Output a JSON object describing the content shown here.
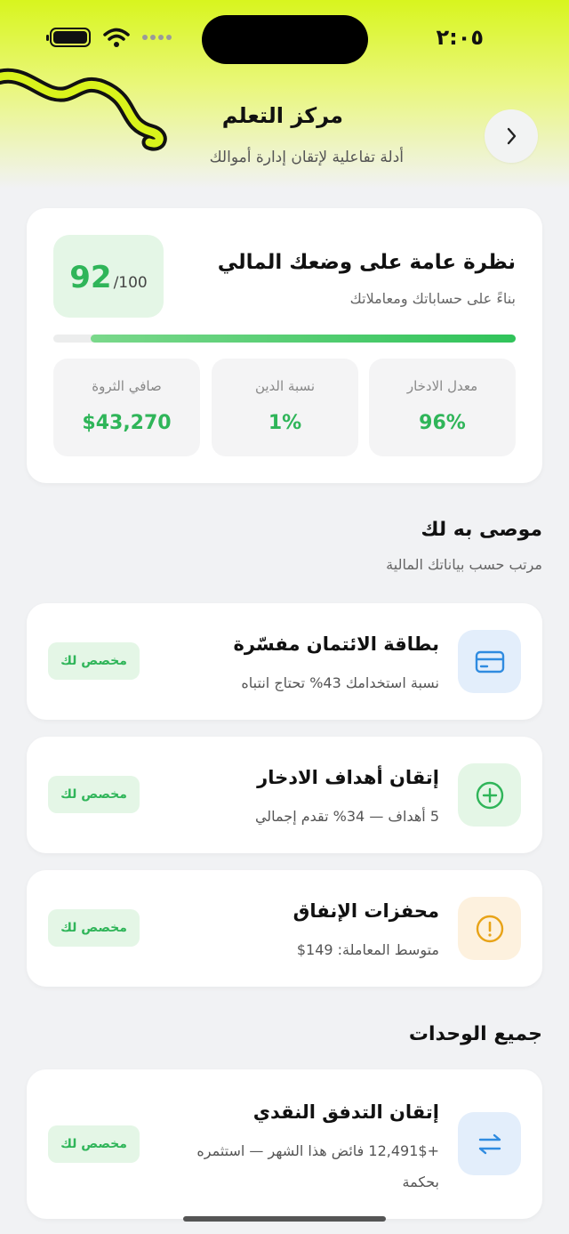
{
  "status": {
    "time": "٢:٠٥"
  },
  "header": {
    "title": "مركز التعلم",
    "subtitle": "أدلة تفاعلية لإتقان إدارة أموالك",
    "back_icon": "chevron-right-icon"
  },
  "overview": {
    "title": "نظرة عامة على وضعك المالي",
    "subtitle": "بناءً على حساباتك ومعاملاتك",
    "score": "92",
    "score_max": "/100",
    "progress_fraction": 0.92,
    "metrics": [
      {
        "label": "معدل الادخار",
        "value": "96%"
      },
      {
        "label": "نسبة الدين",
        "value": "1%"
      },
      {
        "label": "صافي الثروة",
        "value": "$43,270"
      }
    ]
  },
  "recommended": {
    "title": "موصى به لك",
    "subtitle": "مرتب حسب بياناتك المالية",
    "items": [
      {
        "title": "بطاقة الائتمان مفسّرة",
        "subtitle": "نسبة استخدامك 43% تحتاج انتباه",
        "badge": "مخصص لك",
        "icon": "credit-card-icon",
        "color": "#2f8be0"
      },
      {
        "title": "إتقان أهداف الادخار",
        "subtitle": "5 أهداف — 34% تقدم إجمالي",
        "badge": "مخصص لك",
        "icon": "plus-circle-icon",
        "color": "#2fb559"
      },
      {
        "title": "محفزات الإنفاق",
        "subtitle": "متوسط المعاملة: 149$",
        "badge": "مخصص لك",
        "icon": "alert-circle-icon",
        "color": "#e8a317"
      }
    ]
  },
  "all_modules": {
    "title": "جميع الوحدات",
    "items": [
      {
        "title": "إتقان التدفق النقدي",
        "subtitle_line1": "+12,491$ فائض هذا الشهر — استثمره",
        "subtitle_line2": "بحكمة",
        "badge": "مخصص لك",
        "icon": "transfer-arrows-icon",
        "color": "#2f8be0"
      }
    ]
  }
}
